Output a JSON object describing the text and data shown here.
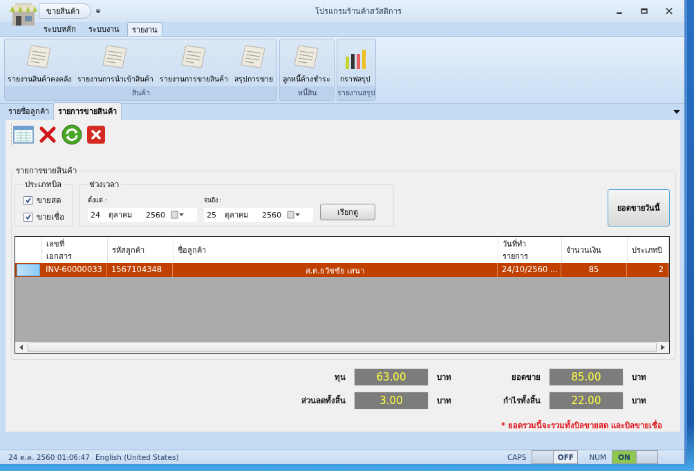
{
  "app_menu": {
    "label": "ขายสินค้า"
  },
  "window": {
    "title": "โปรแกรมร้านค้าสวัสดิการ"
  },
  "ribbon": {
    "tabs": [
      {
        "label": "ระบบหลัก",
        "selected": false
      },
      {
        "label": "ระบบงาน",
        "selected": false
      },
      {
        "label": "รายงาน",
        "selected": true
      }
    ],
    "groups": [
      {
        "label": "สินค้า",
        "buttons": [
          {
            "label": "รายงานสินค้าคงคลัง",
            "kind": "document"
          },
          {
            "label": "รายงานการนำเข้าสินค้า",
            "kind": "document"
          },
          {
            "label": "รายงานการขายสินค้า",
            "kind": "document"
          },
          {
            "label": "สรุปการขาย",
            "kind": "document"
          }
        ]
      },
      {
        "label": "หนี้สิน",
        "buttons": [
          {
            "label": "ลูกหนี้ค้างชำระ",
            "kind": "document"
          }
        ]
      },
      {
        "label": "รายงานสรุป",
        "buttons": [
          {
            "label": "กราฟสรุป",
            "kind": "chart"
          }
        ]
      }
    ]
  },
  "doc_tabs": [
    {
      "label": "รายชื่อลูกค้า",
      "selected": false
    },
    {
      "label": "รายการขายสินค้า",
      "selected": true
    }
  ],
  "panel": {
    "title": "รายการขายสินค้า",
    "bill_types": {
      "title": "ประเภทบิล",
      "options": [
        {
          "label": "ขายสด",
          "checked": true
        },
        {
          "label": "ขายเชื่อ",
          "checked": true
        }
      ]
    },
    "date_range": {
      "title": "ช่วงเวลา",
      "from": {
        "label": "ตั้งแต่ :",
        "day": "24",
        "month": "ตุลาคม",
        "year": "2560"
      },
      "to": {
        "label": "จนถึง :",
        "day": "25",
        "month": "ตุลาคม",
        "year": "2560"
      },
      "search_button": "เรียกดู"
    },
    "today_button": "ยอดขายวันนี้",
    "table": {
      "columns": [
        "เลขที่\nเอกสาร",
        "รหัสลูกค้า",
        "ชื่อลูกค้า",
        "วันที่ทำ\nรายการ",
        "จำนวนเงิน",
        "ประเภทบิ"
      ],
      "rows": [
        {
          "selected": true,
          "cells": [
            "INV-60000033",
            "1567104348",
            "ส.ต.ธวัชชัย  เสนา",
            "24/10/2560 ...",
            "85",
            "2"
          ]
        }
      ]
    }
  },
  "summary": [
    {
      "label": "ทุน",
      "value": "63.00",
      "unit": "บาท"
    },
    {
      "label": "ยอดขาย",
      "value": "85.00",
      "unit": "บาท"
    },
    {
      "label": "ส่วนลดทั้งสิ้น",
      "value": "3.00",
      "unit": "บาท"
    },
    {
      "label": "กำไรทั้งสิ้น",
      "value": "22.00",
      "unit": "บาท"
    }
  ],
  "note": "* ยอดรวมนี้จะรวมทั้งบิลขายสด และบิลขายเชื่อ",
  "status_bar": {
    "datetime": "24 ต.ค. 2560  01:06:47",
    "language": "English (United States)",
    "toggles": [
      {
        "label": "CAPS",
        "state": "OFF",
        "on": false
      },
      {
        "label": "NUM",
        "state": "ON",
        "on": true
      }
    ]
  }
}
